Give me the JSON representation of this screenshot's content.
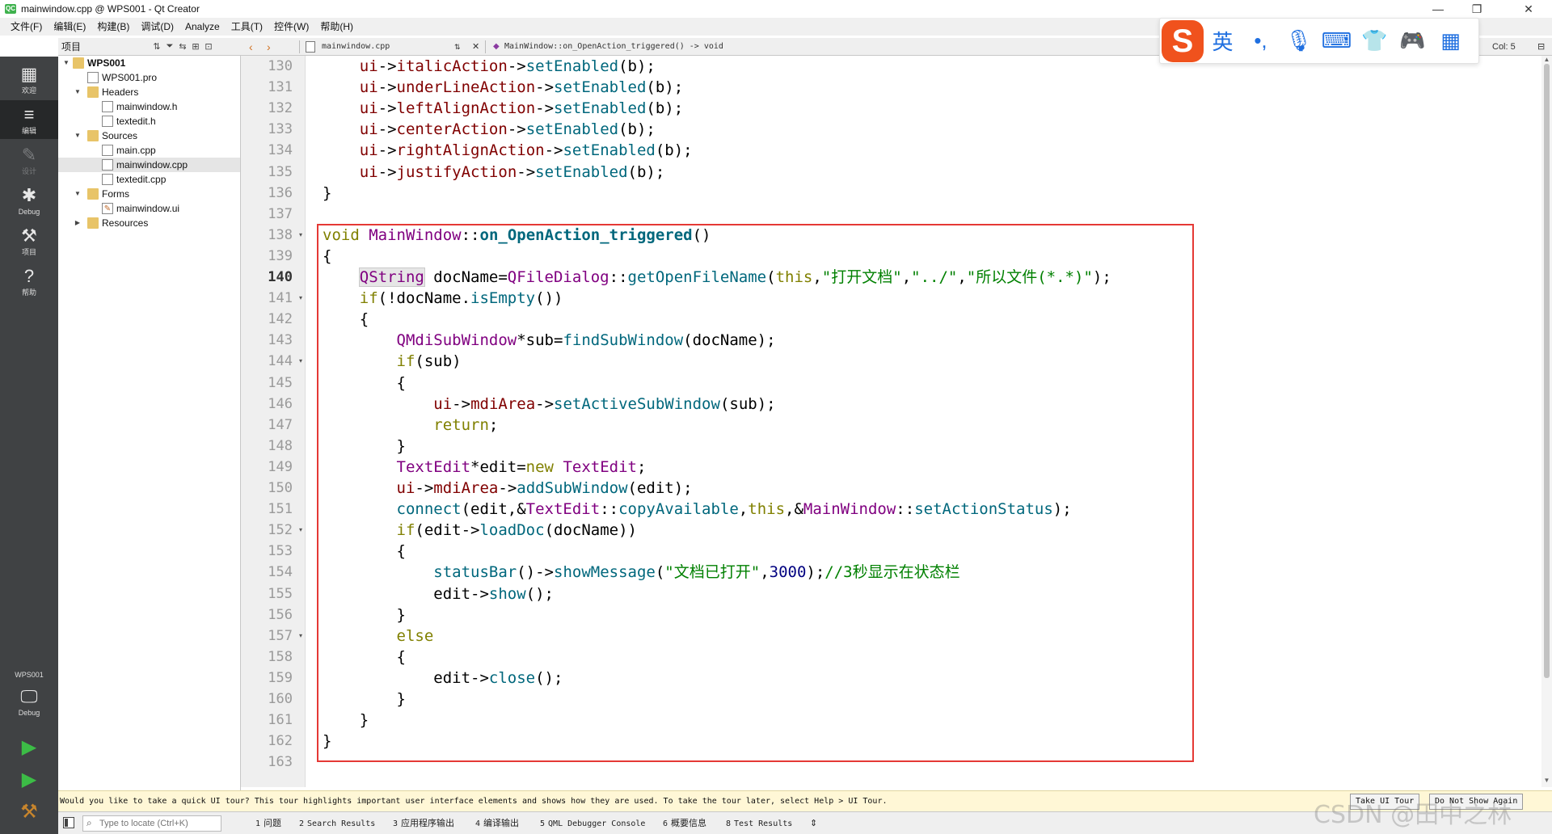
{
  "window": {
    "title": "mainwindow.cpp @ WPS001 - Qt Creator",
    "app_icon": "QC",
    "controls": {
      "minimize": "—",
      "maximize": "❐",
      "close": "✕"
    }
  },
  "menubar": {
    "items": [
      "文件(F)",
      "编辑(E)",
      "构建(B)",
      "调试(D)",
      "Analyze",
      "工具(T)",
      "控件(W)",
      "帮助(H)"
    ]
  },
  "modebar": {
    "modes": [
      {
        "label": "欢迎",
        "icon": "grid-icon",
        "glyph": "▦"
      },
      {
        "label": "编辑",
        "icon": "edit-doc-icon",
        "glyph": "≡"
      },
      {
        "label": "设计",
        "icon": "pencil-icon",
        "glyph": "✎"
      },
      {
        "label": "Debug",
        "icon": "bug-icon",
        "glyph": "✱"
      },
      {
        "label": "项目",
        "icon": "wrench-icon",
        "glyph": "⚒"
      },
      {
        "label": "帮助",
        "icon": "help-icon",
        "glyph": "?"
      }
    ],
    "project_label": "WPS001",
    "kit_label": "Debug",
    "monitor_glyph": "🖵",
    "run_glyph": "▶",
    "debug_run_glyph": "▶",
    "build_glyph": "⚒"
  },
  "project_panel": {
    "title": "项目",
    "tools": {
      "sort": "⇅",
      "filter": "⏷",
      "link": "⇆",
      "split": "⊞",
      "close": "⊡"
    },
    "tree": [
      {
        "label": "WPS001",
        "level": 0,
        "kind": "project",
        "expanded": true,
        "bold": true
      },
      {
        "label": "WPS001.pro",
        "level": 1,
        "kind": "file"
      },
      {
        "label": "Headers",
        "level": 1,
        "kind": "folder",
        "expanded": true
      },
      {
        "label": "mainwindow.h",
        "level": 2,
        "kind": "file"
      },
      {
        "label": "textedit.h",
        "level": 2,
        "kind": "file"
      },
      {
        "label": "Sources",
        "level": 1,
        "kind": "folder",
        "expanded": true
      },
      {
        "label": "main.cpp",
        "level": 2,
        "kind": "file"
      },
      {
        "label": "mainwindow.cpp",
        "level": 2,
        "kind": "file",
        "selected": true
      },
      {
        "label": "textedit.cpp",
        "level": 2,
        "kind": "file"
      },
      {
        "label": "Forms",
        "level": 1,
        "kind": "folder",
        "expanded": true
      },
      {
        "label": "mainwindow.ui",
        "level": 2,
        "kind": "ui-file"
      },
      {
        "label": "Resources",
        "level": 1,
        "kind": "folder",
        "expanded": false
      }
    ]
  },
  "editor_toolbar": {
    "back": "‹",
    "forward": "›",
    "file_name": "mainwindow.cpp",
    "symbol": "MainWindow::on_OpenAction_triggered() -> void",
    "close": "✕",
    "col": "Col: 5",
    "split": "⊟"
  },
  "ime": {
    "logo": "S",
    "icons": [
      {
        "name": "english-mode-icon",
        "glyph": "英"
      },
      {
        "name": "punctuation-icon",
        "glyph": "•,"
      },
      {
        "name": "microphone-icon",
        "glyph": "🎙"
      },
      {
        "name": "keyboard-icon",
        "glyph": "⌨"
      },
      {
        "name": "skin-shirt-icon",
        "glyph": "👕"
      },
      {
        "name": "gamepad-icon",
        "glyph": "🎮"
      },
      {
        "name": "toolbox-grid-icon",
        "glyph": "▦"
      }
    ]
  },
  "editor": {
    "current_line": 140,
    "lines": [
      {
        "n": 130,
        "fold": "",
        "tokens": [
          [
            "    ",
            ""
          ],
          [
            "ui",
            "mem"
          ],
          [
            "->",
            ""
          ],
          [
            "italicAction",
            "mem"
          ],
          [
            "->",
            ""
          ],
          [
            "setEnabled",
            "fn"
          ],
          [
            "(b);",
            ""
          ]
        ]
      },
      {
        "n": 131,
        "fold": "",
        "tokens": [
          [
            "    ",
            ""
          ],
          [
            "ui",
            "mem"
          ],
          [
            "->",
            ""
          ],
          [
            "underLineAction",
            "mem"
          ],
          [
            "->",
            ""
          ],
          [
            "setEnabled",
            "fn"
          ],
          [
            "(b);",
            ""
          ]
        ]
      },
      {
        "n": 132,
        "fold": "",
        "tokens": [
          [
            "    ",
            ""
          ],
          [
            "ui",
            "mem"
          ],
          [
            "->",
            ""
          ],
          [
            "leftAlignAction",
            "mem"
          ],
          [
            "->",
            ""
          ],
          [
            "setEnabled",
            "fn"
          ],
          [
            "(b);",
            ""
          ]
        ]
      },
      {
        "n": 133,
        "fold": "",
        "tokens": [
          [
            "    ",
            ""
          ],
          [
            "ui",
            "mem"
          ],
          [
            "->",
            ""
          ],
          [
            "centerAction",
            "mem"
          ],
          [
            "->",
            ""
          ],
          [
            "setEnabled",
            "fn"
          ],
          [
            "(b);",
            ""
          ]
        ]
      },
      {
        "n": 134,
        "fold": "",
        "tokens": [
          [
            "    ",
            ""
          ],
          [
            "ui",
            "mem"
          ],
          [
            "->",
            ""
          ],
          [
            "rightAlignAction",
            "mem"
          ],
          [
            "->",
            ""
          ],
          [
            "setEnabled",
            "fn"
          ],
          [
            "(b);",
            ""
          ]
        ]
      },
      {
        "n": 135,
        "fold": "",
        "tokens": [
          [
            "    ",
            ""
          ],
          [
            "ui",
            "mem"
          ],
          [
            "->",
            ""
          ],
          [
            "justifyAction",
            "mem"
          ],
          [
            "->",
            ""
          ],
          [
            "setEnabled",
            "fn"
          ],
          [
            "(b);",
            ""
          ]
        ]
      },
      {
        "n": 136,
        "fold": "",
        "tokens": [
          [
            "}",
            ""
          ]
        ]
      },
      {
        "n": 137,
        "fold": "",
        "tokens": []
      },
      {
        "n": 138,
        "fold": "▾",
        "tokens": [
          [
            "void",
            "k"
          ],
          [
            " ",
            ""
          ],
          [
            "MainWindow",
            "ty"
          ],
          [
            "::",
            ""
          ],
          [
            "on_OpenAction_triggered",
            "fd"
          ],
          [
            "()",
            ""
          ]
        ]
      },
      {
        "n": 139,
        "fold": "",
        "tokens": [
          [
            "{",
            ""
          ]
        ]
      },
      {
        "n": 140,
        "fold": "",
        "tokens": [
          [
            "    ",
            ""
          ],
          [
            "|",
            "caret"
          ],
          [
            "QString",
            "ty hl"
          ],
          [
            " docName=",
            ""
          ],
          [
            "QFileDialog",
            "ty"
          ],
          [
            "::",
            ""
          ],
          [
            "getOpenFileName",
            "fn"
          ],
          [
            "(",
            ""
          ],
          [
            "this",
            "k"
          ],
          [
            ",",
            ""
          ],
          [
            "\"打开文档\"",
            "st"
          ],
          [
            ",",
            ""
          ],
          [
            "\"../\"",
            "st"
          ],
          [
            ",",
            ""
          ],
          [
            "\"所以文件(*.*)\"",
            "st"
          ],
          [
            ");",
            ""
          ]
        ]
      },
      {
        "n": 141,
        "fold": "▾",
        "tokens": [
          [
            "    ",
            ""
          ],
          [
            "if",
            "k"
          ],
          [
            "(!docName.",
            ""
          ],
          [
            "isEmpty",
            "fn"
          ],
          [
            "())",
            ""
          ]
        ]
      },
      {
        "n": 142,
        "fold": "",
        "tokens": [
          [
            "    {",
            ""
          ]
        ]
      },
      {
        "n": 143,
        "fold": "",
        "tokens": [
          [
            "        ",
            ""
          ],
          [
            "QMdiSubWindow",
            "ty"
          ],
          [
            "*sub=",
            ""
          ],
          [
            "findSubWindow",
            "fn"
          ],
          [
            "(docName);",
            ""
          ]
        ]
      },
      {
        "n": 144,
        "fold": "▾",
        "tokens": [
          [
            "        ",
            ""
          ],
          [
            "if",
            "k"
          ],
          [
            "(sub)",
            ""
          ]
        ]
      },
      {
        "n": 145,
        "fold": "",
        "tokens": [
          [
            "        {",
            ""
          ]
        ]
      },
      {
        "n": 146,
        "fold": "",
        "tokens": [
          [
            "            ",
            ""
          ],
          [
            "ui",
            "mem"
          ],
          [
            "->",
            ""
          ],
          [
            "mdiArea",
            "mem"
          ],
          [
            "->",
            ""
          ],
          [
            "setActiveSubWindow",
            "fn"
          ],
          [
            "(sub);",
            ""
          ]
        ]
      },
      {
        "n": 147,
        "fold": "",
        "tokens": [
          [
            "            ",
            ""
          ],
          [
            "return",
            "k"
          ],
          [
            ";",
            ""
          ]
        ]
      },
      {
        "n": 148,
        "fold": "",
        "tokens": [
          [
            "        }",
            ""
          ]
        ]
      },
      {
        "n": 149,
        "fold": "",
        "tokens": [
          [
            "        ",
            ""
          ],
          [
            "TextEdit",
            "ty"
          ],
          [
            "*edit=",
            ""
          ],
          [
            "new",
            "k"
          ],
          [
            " ",
            ""
          ],
          [
            "TextEdit",
            "ty"
          ],
          [
            ";",
            ""
          ]
        ]
      },
      {
        "n": 150,
        "fold": "",
        "tokens": [
          [
            "        ",
            ""
          ],
          [
            "ui",
            "mem"
          ],
          [
            "->",
            ""
          ],
          [
            "mdiArea",
            "mem"
          ],
          [
            "->",
            ""
          ],
          [
            "addSubWindow",
            "fn"
          ],
          [
            "(edit);",
            ""
          ]
        ]
      },
      {
        "n": 151,
        "fold": "",
        "tokens": [
          [
            "        ",
            ""
          ],
          [
            "connect",
            "fn"
          ],
          [
            "(edit,&",
            ""
          ],
          [
            "TextEdit",
            "ty"
          ],
          [
            "::",
            ""
          ],
          [
            "copyAvailable",
            "fn"
          ],
          [
            ",",
            ""
          ],
          [
            "this",
            "k"
          ],
          [
            ",&",
            ""
          ],
          [
            "MainWindow",
            "ty"
          ],
          [
            "::",
            ""
          ],
          [
            "setActionStatus",
            "fn"
          ],
          [
            ");",
            ""
          ]
        ]
      },
      {
        "n": 152,
        "fold": "▾",
        "tokens": [
          [
            "        ",
            ""
          ],
          [
            "if",
            "k"
          ],
          [
            "(edit->",
            ""
          ],
          [
            "loadDoc",
            "fn"
          ],
          [
            "(docName))",
            ""
          ]
        ]
      },
      {
        "n": 153,
        "fold": "",
        "tokens": [
          [
            "        {",
            ""
          ]
        ]
      },
      {
        "n": 154,
        "fold": "",
        "tokens": [
          [
            "            ",
            ""
          ],
          [
            "statusBar",
            "fn"
          ],
          [
            "()->",
            ""
          ],
          [
            "showMessage",
            "fn"
          ],
          [
            "(",
            ""
          ],
          [
            "\"文档已打开\"",
            "st"
          ],
          [
            ",",
            ""
          ],
          [
            "3000",
            "nu"
          ],
          [
            ");",
            ""
          ],
          [
            "//3秒显示在状态栏",
            "cm"
          ]
        ]
      },
      {
        "n": 155,
        "fold": "",
        "tokens": [
          [
            "            edit->",
            ""
          ],
          [
            "show",
            "fn"
          ],
          [
            "();",
            ""
          ]
        ]
      },
      {
        "n": 156,
        "fold": "",
        "tokens": [
          [
            "        }",
            ""
          ]
        ]
      },
      {
        "n": 157,
        "fold": "▾",
        "tokens": [
          [
            "        ",
            ""
          ],
          [
            "else",
            "k"
          ]
        ]
      },
      {
        "n": 158,
        "fold": "",
        "tokens": [
          [
            "        {",
            ""
          ]
        ]
      },
      {
        "n": 159,
        "fold": "",
        "tokens": [
          [
            "            edit->",
            ""
          ],
          [
            "close",
            "fn"
          ],
          [
            "();",
            ""
          ]
        ]
      },
      {
        "n": 160,
        "fold": "",
        "tokens": [
          [
            "        }",
            ""
          ]
        ]
      },
      {
        "n": 161,
        "fold": "",
        "tokens": [
          [
            "    }",
            ""
          ]
        ]
      },
      {
        "n": 162,
        "fold": "",
        "tokens": [
          [
            "}",
            ""
          ]
        ]
      },
      {
        "n": 163,
        "fold": "",
        "tokens": []
      }
    ]
  },
  "infobar": {
    "message": "Would you like to take a quick UI tour? This tour highlights important user interface elements and shows how they are used. To take the tour later, select Help > UI Tour.",
    "take_tour": "Take UI Tour",
    "dont_show": "Do Not Show Again"
  },
  "statusbar": {
    "search_glyph": "⌕",
    "locator_placeholder": "Type to locate (Ctrl+K)",
    "tabs": [
      {
        "num": "1",
        "label": "问题"
      },
      {
        "num": "2",
        "label": "Search Results"
      },
      {
        "num": "3",
        "label": "应用程序输出"
      },
      {
        "num": "4",
        "label": "编译输出"
      },
      {
        "num": "5",
        "label": "QML Debugger Console"
      },
      {
        "num": "6",
        "label": "概要信息"
      },
      {
        "num": "8",
        "label": "Test Results"
      }
    ],
    "more": "⇕"
  },
  "watermark": "CSDN @田中之林",
  "colors": {
    "mode_bar": "#404244",
    "highlight_box": "#e53935",
    "ime_logo": "#f0521d",
    "ime_icons": "#1f6fe0"
  }
}
